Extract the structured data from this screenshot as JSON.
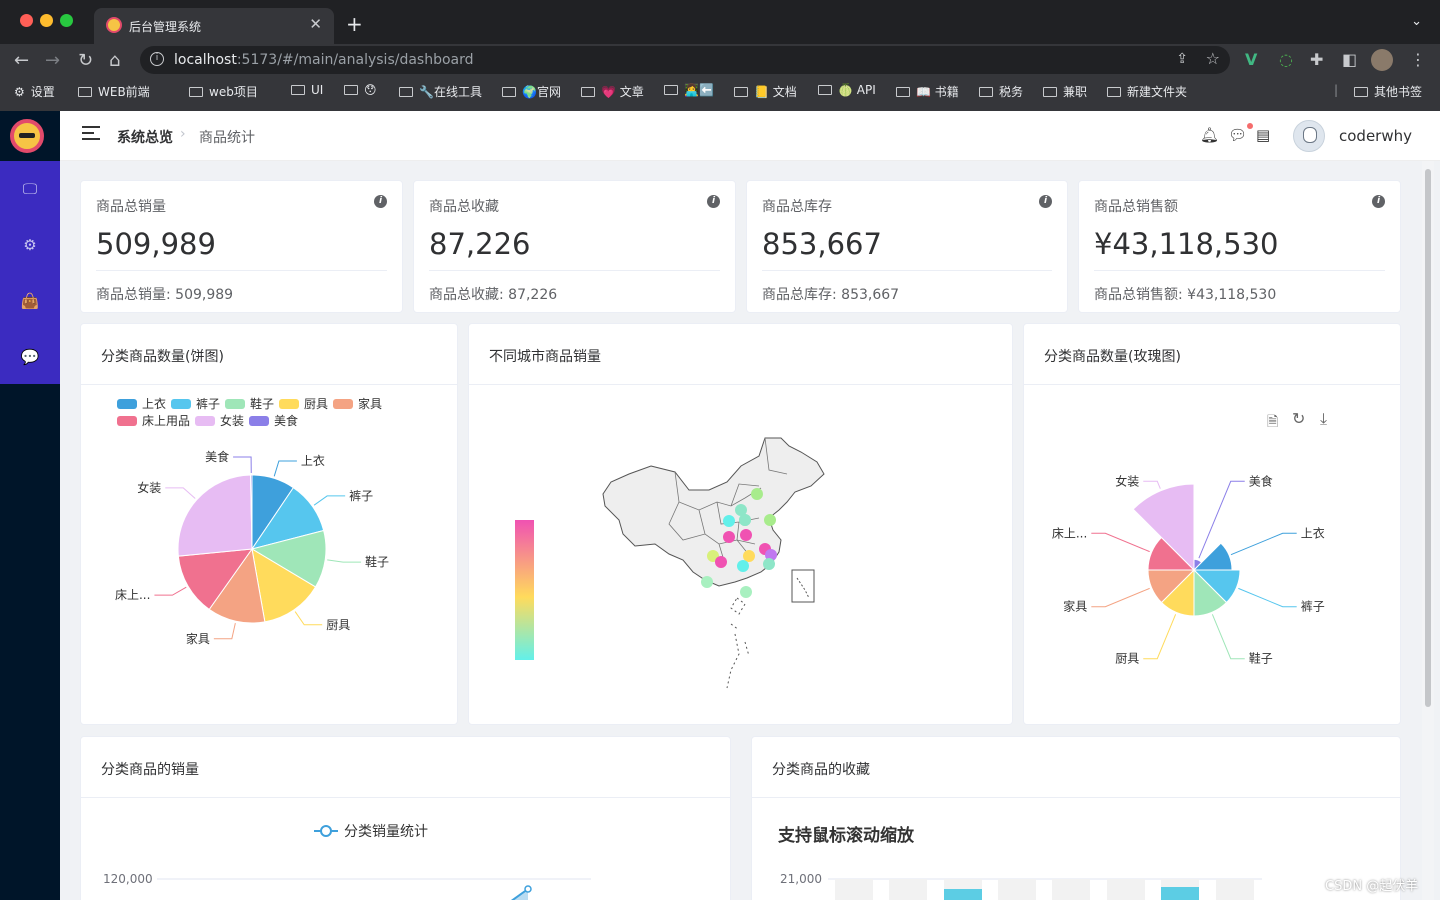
{
  "browser": {
    "tab_title": "后台管理系统",
    "tab_close": "✕",
    "new_tab": "+",
    "url_host": "localhost",
    "url_path": ":5173/#/main/analysis/dashboard",
    "bookmarks": [
      "设置",
      "WEB前端",
      "web项目",
      "UI",
      "😯",
      "🔧在线工具",
      "🌍官网",
      "💗 文章",
      "👩‍💻⬅️",
      "📒 文档",
      "🍈 API",
      "📖 书籍",
      "税务",
      "兼职",
      "新建文件夹"
    ],
    "other_bookmarks": "其他书签"
  },
  "header": {
    "crumb_root": "系统总览",
    "crumb_sep": "›",
    "crumb_current": "商品统计",
    "username": "coderwhy"
  },
  "stats": [
    {
      "label": "商品总销量",
      "value": "509,989",
      "footer": "商品总销量: 509,989"
    },
    {
      "label": "商品总收藏",
      "value": "87,226",
      "footer": "商品总收藏: 87,226"
    },
    {
      "label": "商品总库存",
      "value": "853,667",
      "footer": "商品总库存: 853,667"
    },
    {
      "label": "商品总销售额",
      "value": "¥43,118,530",
      "footer": "商品总销售额: ¥43,118,530"
    }
  ],
  "panels": {
    "pie": "分类商品数量(饼图)",
    "map": "不同城市商品销量",
    "rose": "分类商品数量(玫瑰图)",
    "line": "分类商品的销量",
    "bar": "分类商品的收藏"
  },
  "watermark": "CSDN @起伏羊",
  "chart_data": [
    {
      "type": "pie",
      "categories": [
        "上衣",
        "裤子",
        "鞋子",
        "厨具",
        "家具",
        "床上用品",
        "女装",
        "美食"
      ],
      "label_texts": [
        "上衣",
        "裤子",
        "鞋子",
        "厨具",
        "家具",
        "床上...",
        "女装",
        "美食"
      ],
      "values": [
        0.09,
        0.11,
        0.12,
        0.13,
        0.12,
        0.13,
        0.25,
        0.003
      ],
      "value_unit": "fraction of total (estimated)",
      "colors": [
        "#3ea0dc",
        "#56c6ee",
        "#9fe6b8",
        "#ffdb5c",
        "#f4a383",
        "#f0718f",
        "#e7bcf3",
        "#8b7fe8"
      ],
      "legend": "top-left"
    },
    {
      "type": "scatter",
      "note_style": "map of China with city scatter points and a vertical visual-map color bar",
      "visualmap_colors": [
        "#f052b2",
        "#ffdb5c",
        "#62f0ea"
      ]
    },
    {
      "type": "pie",
      "rose": true,
      "categories": [
        "美食",
        "上衣",
        "裤子",
        "鞋子",
        "厨具",
        "家具",
        "床上用品",
        "女装"
      ],
      "label_texts": [
        "美食",
        "上衣",
        "裤子",
        "鞋子",
        "厨具",
        "家具",
        "床上...",
        "女装"
      ],
      "radius_values": [
        0.06,
        0.4,
        0.5,
        0.5,
        0.5,
        0.5,
        0.5,
        1.0
      ],
      "value_unit": "relative radius (estimated)",
      "colors": [
        "#8b7fe8",
        "#3ea0dc",
        "#56c6ee",
        "#9fe6b8",
        "#ffdb5c",
        "#f4a383",
        "#f0718f",
        "#e7bcf3"
      ],
      "toolbox": [
        "data-view",
        "restore",
        "save-image"
      ]
    },
    {
      "type": "line",
      "legend": "分类销量统计",
      "y_tick_visible": "120,000"
    },
    {
      "type": "bar",
      "title": "支持鼠标滚动缩放",
      "y_tick_visible": "21,000"
    }
  ]
}
